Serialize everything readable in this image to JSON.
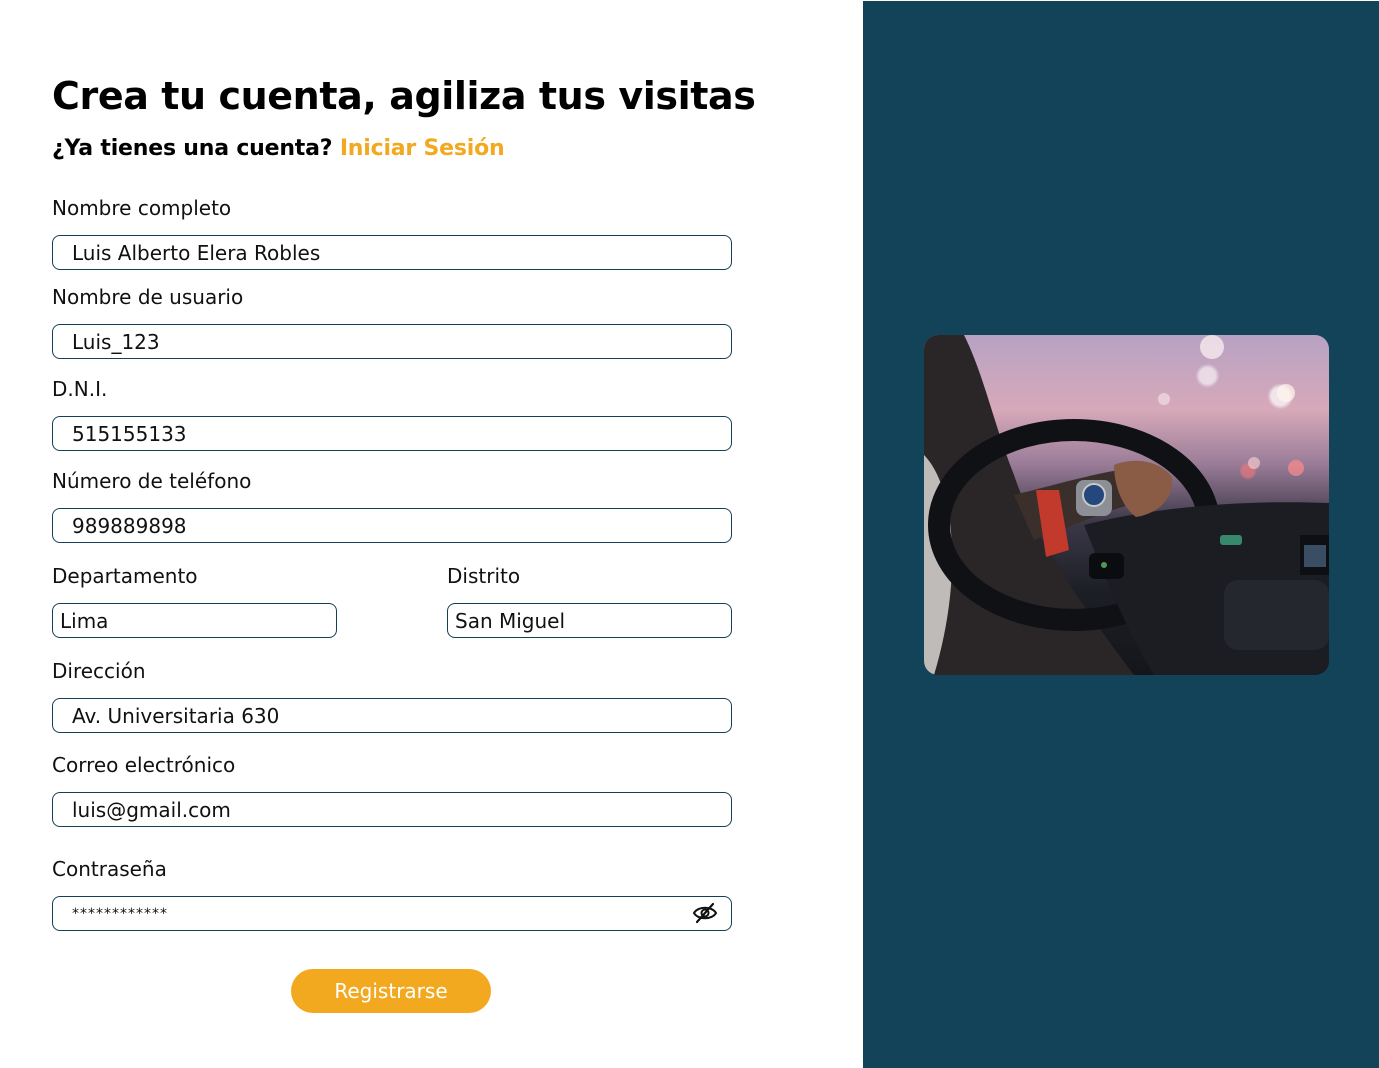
{
  "header": {
    "title": "Crea tu cuenta, agiliza tus visitas",
    "question": "¿Ya tienes una cuenta?",
    "login_link": "Iniciar Sesión"
  },
  "form": {
    "full_name": {
      "label": "Nombre completo",
      "value": "Luis Alberto Elera Robles"
    },
    "username": {
      "label": "Nombre de usuario",
      "value": "Luis_123"
    },
    "dni": {
      "label": "D.N.I.",
      "value": "515155133"
    },
    "phone": {
      "label": "Número de teléfono",
      "value": "989889898"
    },
    "department": {
      "label": "Departamento",
      "value": "Lima"
    },
    "district": {
      "label": "Distrito",
      "value": "San Miguel"
    },
    "address": {
      "label": "Dirección",
      "value": "Av. Universitaria 630"
    },
    "email": {
      "label": "Correo electrónico",
      "value": "luis@gmail.com"
    },
    "password": {
      "label": "Contraseña",
      "value": "************"
    },
    "submit_label": "Registrarse"
  },
  "side_panel": {
    "image": "driver-steering-wheel-photo"
  },
  "colors": {
    "accent": "#f2a91f",
    "panel": "#134359",
    "field_border": "#173e55"
  },
  "icons": {
    "password_toggle": "eye-slash-icon"
  }
}
